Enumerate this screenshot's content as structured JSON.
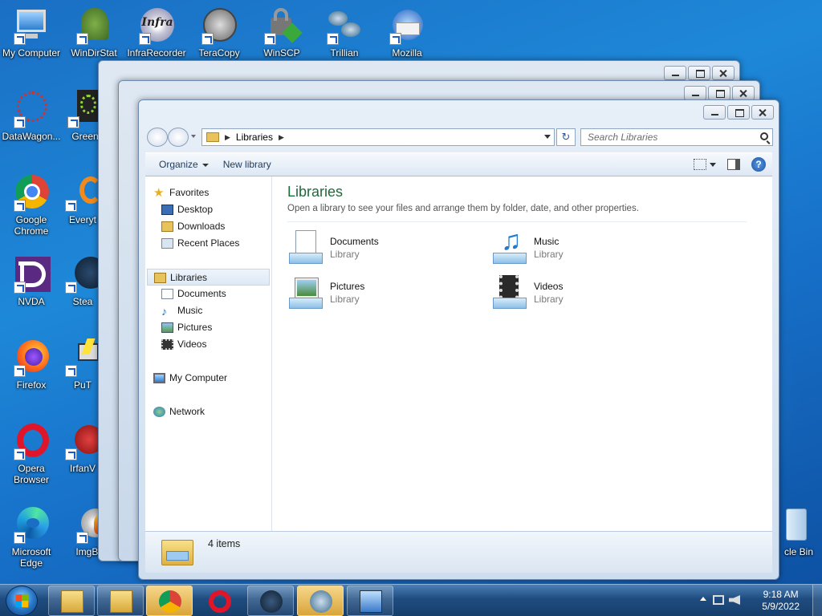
{
  "desktop": {
    "icons": [
      {
        "label": "My Computer"
      },
      {
        "label": "WinDirStat"
      },
      {
        "label": "InfraRecorder"
      },
      {
        "label": "TeraCopy"
      },
      {
        "label": "WinSCP"
      },
      {
        "label": "Trillian"
      },
      {
        "label": "Mozilla"
      },
      {
        "label": "DataWagon..."
      },
      {
        "label": "Green"
      },
      {
        "label": "Google Chrome"
      },
      {
        "label": "Everyt"
      },
      {
        "label": "NVDA"
      },
      {
        "label": "Stea"
      },
      {
        "label": "Firefox"
      },
      {
        "label": "PuT"
      },
      {
        "label": "Opera Browser"
      },
      {
        "label": "IrfanV"
      },
      {
        "label": "Microsoft Edge"
      },
      {
        "label": "ImgBurn"
      },
      {
        "label": "cle Bin"
      }
    ],
    "infra_logo": "Infra"
  },
  "explorer": {
    "address": {
      "breadcrumb": "Libraries",
      "separator": "▶"
    },
    "refresh_glyph": "↻",
    "search_placeholder": "Search Libraries",
    "toolbar": {
      "organize": "Organize",
      "new_library": "New library",
      "help": "?"
    },
    "navigation": {
      "favorites": "Favorites",
      "desktop": "Desktop",
      "downloads": "Downloads",
      "recent": "Recent Places",
      "libraries": "Libraries",
      "documents": "Documents",
      "music": "Music",
      "pictures": "Pictures",
      "videos": "Videos",
      "computer": "My Computer",
      "network": "Network"
    },
    "main": {
      "title": "Libraries",
      "subtitle": "Open a library to see your files and arrange them by folder, date, and other properties.",
      "items": [
        {
          "name": "Documents",
          "kind": "Library"
        },
        {
          "name": "Music",
          "kind": "Library"
        },
        {
          "name": "Pictures",
          "kind": "Library"
        },
        {
          "name": "Videos",
          "kind": "Library"
        }
      ]
    },
    "status": "4 items"
  },
  "taskbar": {
    "time": "9:18 AM",
    "date": "5/9/2022"
  },
  "colors": {
    "library_title": "#1e6a3a",
    "taskbar": "#1f4c80",
    "desktop": "#1a7cd0"
  }
}
